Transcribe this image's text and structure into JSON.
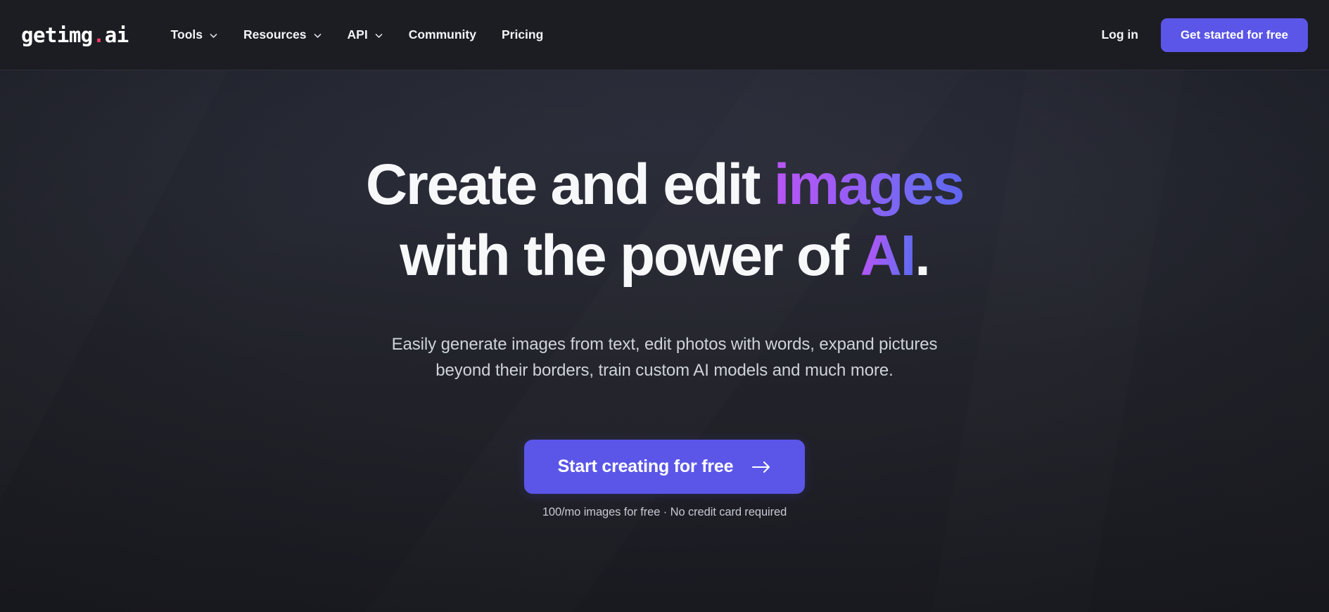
{
  "brand": {
    "name_prefix": "getimg",
    "dot": ".",
    "name_suffix": "ai",
    "dot_color": "#f2376a"
  },
  "header": {
    "nav": [
      {
        "label": "Tools",
        "has_chevron": true,
        "icon": "chevron-down-icon"
      },
      {
        "label": "Resources",
        "has_chevron": true,
        "icon": "chevron-down-icon"
      },
      {
        "label": "API",
        "has_chevron": true,
        "icon": "chevron-down-icon"
      },
      {
        "label": "Community",
        "has_chevron": false
      },
      {
        "label": "Pricing",
        "has_chevron": false
      }
    ],
    "login_label": "Log in",
    "cta_label": "Get started for free",
    "cta_color": "#5b56e8"
  },
  "hero": {
    "headline": {
      "line1_plain": "Create and edit ",
      "line1_accent": "images",
      "line2_plain": "with the power of ",
      "line2_accent": "AI",
      "line2_suffix": "."
    },
    "subheadline": {
      "line1": "Easily generate images from text, edit photos with words, expand pictures",
      "line2": "beyond their borders, train custom AI models and much more."
    },
    "cta": {
      "label": "Start creating for free",
      "icon": "arrow-right-icon",
      "color": "#5b56e8"
    },
    "cta_note": "100/mo images for free · No credit card required",
    "gradient_start": "#b955f5",
    "gradient_end": "#5e63ef",
    "background_color": "#22242d"
  }
}
